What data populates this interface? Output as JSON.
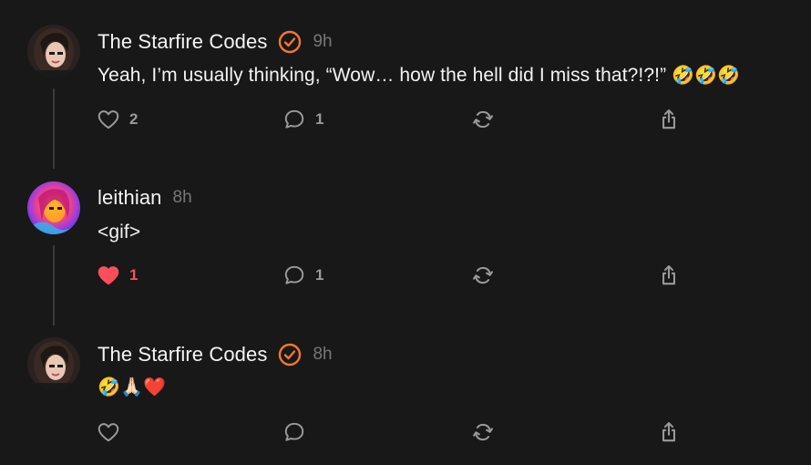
{
  "colors": {
    "background": "#181818",
    "text": "#f3f3f3",
    "muted": "#777777",
    "icon": "#9a9a9a",
    "thread_line": "#3a3a3a",
    "verified": "#f07a29",
    "liked": "#ff4d5e"
  },
  "posts": [
    {
      "username": "The Starfire Codes",
      "verified": true,
      "timestamp": "9h",
      "text": "Yeah, I’m usually thinking, “Wow… how the hell did I miss that?!?!”",
      "emojis": "🤣🤣🤣",
      "likes": "2",
      "replies": "1",
      "liked": false
    },
    {
      "username": "leithian",
      "verified": false,
      "timestamp": "8h",
      "text": "<gif>",
      "likes": "1",
      "replies": "1",
      "liked": true
    },
    {
      "username": "The Starfire Codes",
      "verified": true,
      "timestamp": "8h",
      "emojis": "🤣🙏🏻❤️",
      "liked": false
    }
  ],
  "icons": {
    "like": "heart-icon",
    "like_filled": "heart-filled-icon",
    "reply": "reply-bubble-icon",
    "repost": "repost-icon",
    "share": "share-icon",
    "verified": "verified-badge-icon"
  }
}
